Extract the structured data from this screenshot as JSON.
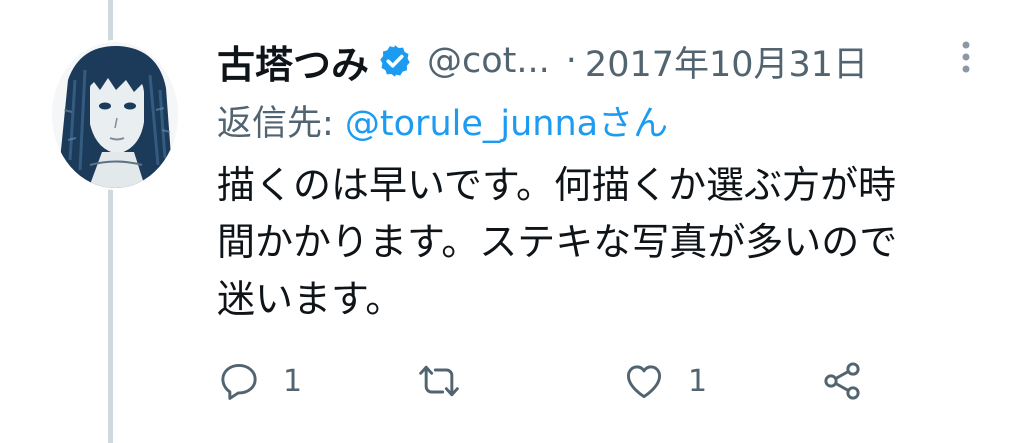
{
  "tweet": {
    "display_name": "古塔つみ",
    "handle": "@cot...",
    "separator": "·",
    "date": "2017年10月31日",
    "reply_prefix": "返信先: ",
    "reply_mention": "@torule_junna",
    "reply_suffix": "さん",
    "text_lines": [
      "描くのは早いです。何描くか選ぶ方が時",
      "間かかります。ステキな写真が多いので",
      "迷います。"
    ]
  },
  "actions": {
    "reply_count": "1",
    "like_count": "1"
  },
  "icons": {
    "verified": "verified-badge-icon",
    "more": "more-options-icon",
    "reply": "reply-icon",
    "retweet": "retweet-icon",
    "like": "heart-icon",
    "share": "share-icon"
  },
  "colors": {
    "accent": "#1d9bf0",
    "secondary_text": "#536471",
    "primary_text": "#0f1419",
    "thread_line": "#cfd9de"
  }
}
